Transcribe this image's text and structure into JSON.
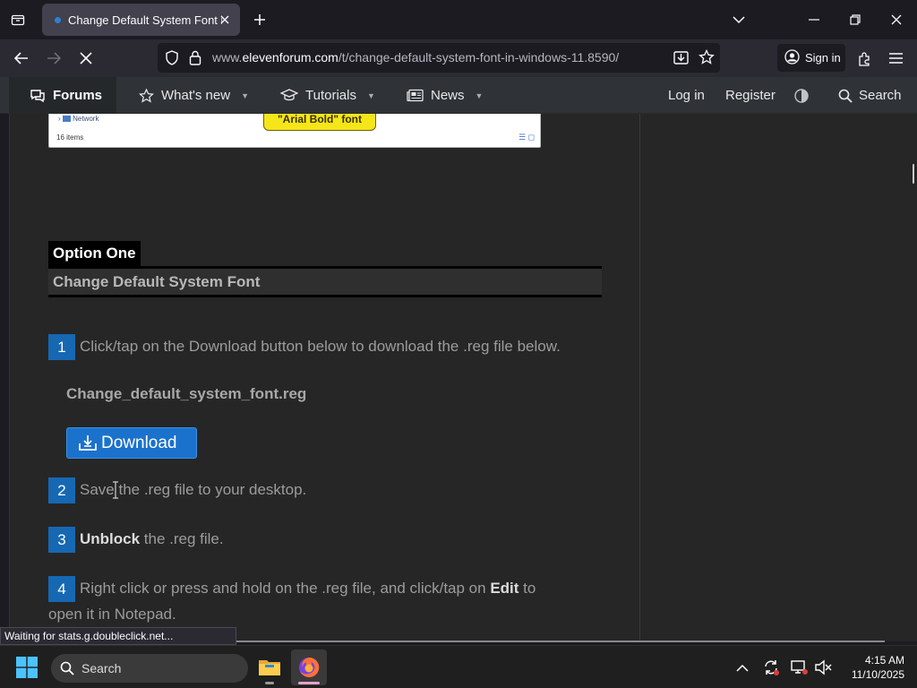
{
  "browser": {
    "tab_title": "Change Default System Font in",
    "url_prefix": "www.",
    "url_domain": "elevenforum.com",
    "url_path": "/t/change-default-system-font-in-windows-11.8590/",
    "sign_in_label": "Sign in",
    "status_text": "Waiting for stats.g.doubleclick.net..."
  },
  "site_nav": {
    "forums": "Forums",
    "whats_new": "What's new",
    "tutorials": "Tutorials",
    "news": "News",
    "login": "Log in",
    "register": "Register",
    "search": "Search"
  },
  "article": {
    "screenshot_network": "Network",
    "screenshot_items": "16 items",
    "screenshot_callout": "\"Arial Bold\" font",
    "option_title": "Option One",
    "option_subtitle": "Change Default System Font",
    "step1_num": "1",
    "step1_text": "Click/tap on the Download button below to download the .reg file below.",
    "reg_filename": "Change_default_system_font.reg",
    "download_label": "Download",
    "step2_num": "2",
    "step2_text": "Save the .reg file to your desktop.",
    "step3_num": "3",
    "step3_bold": "Unblock",
    "step3_text": " the .reg file.",
    "step4_num": "4",
    "step4_text_a": "Right click or press and hold on the .reg file, and click/tap on ",
    "step4_bold": "Edit",
    "step4_text_b": " to",
    "step4_text_c": "open it in Notepad."
  },
  "taskbar": {
    "search_label": "Search",
    "time": "4:15 AM",
    "date": "11/10/2025"
  },
  "colors": {
    "accent_blue": "#1b72cc",
    "step_badge": "#1668b3",
    "callout_yellow": "#f5e61a"
  }
}
